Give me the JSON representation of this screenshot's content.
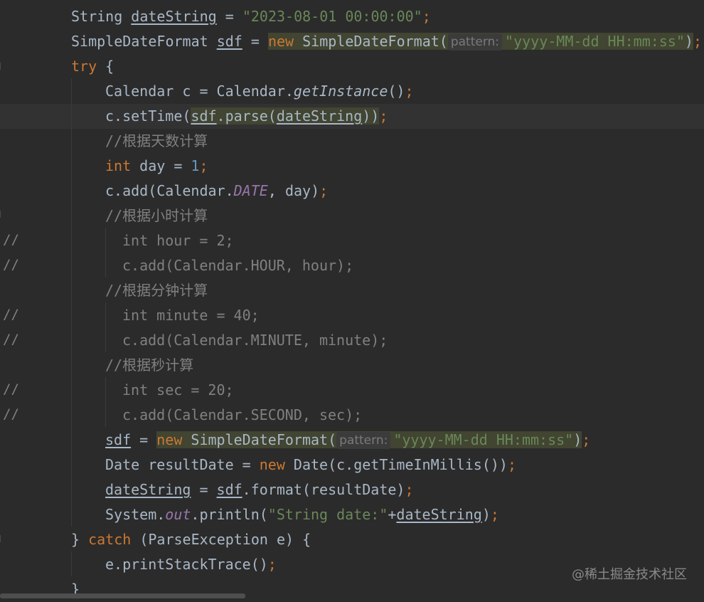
{
  "gutter": {
    "comment_markers": [
      "//",
      "//",
      "//",
      "//",
      "//",
      "//"
    ]
  },
  "code": {
    "l1": {
      "type": "String",
      "var": "dateString",
      "eq": " = ",
      "str": "\"2023-08-01 00:00:00\"",
      "semi": ";"
    },
    "l2": {
      "type": "SimpleDateFormat ",
      "var": "sdf",
      "eq": " = ",
      "kw": "new",
      "ctor": " SimpleDateFormat(",
      "hint": "pattern:",
      "str": "\"yyyy-MM-dd HH:mm:ss\"",
      "close": ")",
      "semi": ";"
    },
    "l3": {
      "kw": "try",
      "rest": " {"
    },
    "l4": {
      "a": "Calendar c = Calendar.",
      "method": "getInstance",
      "b": "()",
      "semi": ";"
    },
    "l5": {
      "a": "c.setTime(",
      "var": "sdf",
      "b": ".parse(",
      "arg": "dateString",
      "c": "))",
      "semi": ";"
    },
    "l6": {
      "comment": "//根据天数计算"
    },
    "l7": {
      "kw": "int",
      "a": " day = ",
      "num": "1",
      "semi": ";"
    },
    "l8": {
      "a": "c.add(Calendar.",
      "field": "DATE",
      "b": ", day)",
      "semi": ";"
    },
    "l9": {
      "comment": "//根据小时计算"
    },
    "l10": {
      "text": "int hour = 2;"
    },
    "l11": {
      "text": "c.add(Calendar.HOUR, hour);"
    },
    "l12": {
      "comment": "//根据分钟计算"
    },
    "l13": {
      "text": "int minute = 40;"
    },
    "l14": {
      "text": "c.add(Calendar.MINUTE, minute);"
    },
    "l15": {
      "comment": "//根据秒计算"
    },
    "l16": {
      "text": "int sec = 20;"
    },
    "l17": {
      "text": "c.add(Calendar.SECOND, sec);"
    },
    "l18": {
      "var": "sdf",
      "eq": " = ",
      "kw": "new",
      "ctor": " SimpleDateFormat(",
      "hint": "pattern:",
      "str": "\"yyyy-MM-dd HH:mm:ss\"",
      "close": ")",
      "semi": ";"
    },
    "l19": {
      "a": "Date resultDate = ",
      "kw": "new",
      "b": " Date(c.getTimeInMillis())",
      "semi": ";"
    },
    "l20": {
      "var": "dateString",
      "eq": " = ",
      "var2": "sdf",
      "a": ".format(resultDate)",
      "semi": ";"
    },
    "l21": {
      "a": "System.",
      "field": "out",
      "b": ".println(",
      "str": "\"String date:\"",
      "c": "+",
      "var": "dateString",
      "d": ")",
      "semi": ";"
    },
    "l22": {
      "a": "} ",
      "kw": "catch",
      "b": " (ParseException e) {"
    },
    "l23": {
      "a": "e.printStackTrace()",
      "semi": ";"
    },
    "l24": {
      "a": "}"
    }
  },
  "watermark": "@稀土掘金技术社区",
  "colors": {
    "background": "#2b2b2b",
    "keyword": "#cc7832",
    "string": "#6a8759",
    "number": "#6897bb",
    "comment": "#808080",
    "field": "#9876aa",
    "default": "#a9b7c6"
  }
}
